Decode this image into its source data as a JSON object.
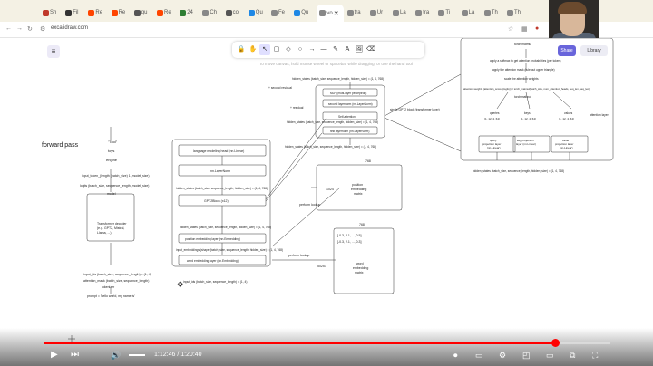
{
  "browser": {
    "url": "excalidraw.com",
    "active_tab_close": "✕",
    "tabs": [
      {
        "label": "Sh",
        "color": "#c0392b"
      },
      {
        "label": "Fil",
        "color": "#333"
      },
      {
        "label": "Re",
        "color": "#ff4500"
      },
      {
        "label": "Re",
        "color": "#ff4500"
      },
      {
        "label": "qu",
        "color": "#555"
      },
      {
        "label": "Re",
        "color": "#ff4500"
      },
      {
        "label": "24",
        "color": "#2e7d32"
      },
      {
        "label": "Ch",
        "color": "#888"
      },
      {
        "label": "co",
        "color": "#555"
      },
      {
        "label": "Qu",
        "color": "#1e88e5"
      },
      {
        "label": "Fe",
        "color": "#888"
      },
      {
        "label": "Qu",
        "color": "#1e88e5"
      },
      {
        "label": "vo",
        "color": "#888"
      },
      {
        "label": "tra",
        "color": "#888"
      },
      {
        "label": "Ur",
        "color": "#888"
      },
      {
        "label": "La",
        "color": "#888"
      },
      {
        "label": "tra",
        "color": "#888"
      },
      {
        "label": "Ti",
        "color": "#888"
      },
      {
        "label": "La",
        "color": "#888"
      },
      {
        "label": "Th",
        "color": "#888"
      },
      {
        "label": "Th",
        "color": "#888"
      }
    ]
  },
  "excalidraw": {
    "hint": "To move canvas, hold mouse wheel or spacebar while dragging, or use the hand tool",
    "share_label": "Share",
    "library_label": "Library",
    "tools": [
      "🔒",
      "✋",
      "↖",
      "▢",
      "◇",
      "○",
      "→",
      "—",
      "✎",
      "A",
      "🖼",
      "⌫"
    ]
  },
  "diagram": {
    "forward_pass": "forward pass",
    "left_col": {
      "text1": "\"Tool\"",
      "text2": "toys",
      "text3": "engine",
      "text4": "input_token_(length (batch_size) 1, model_size)",
      "text5": "logits (batch_size, sequence_length, model_size)",
      "text6": "model",
      "box": [
        "Transformer decoder",
        "(e.g. GPT2, Mistral,",
        "Llama, ...)"
      ],
      "text7": "input_ids (batch_size, sequence_length) = (1, 4)",
      "text8": "attention_mask (batch_size, sequence_length)",
      "text9": "tokenizer",
      "text10": "prompt = 'hello world, my name is'"
    },
    "mid_stack": {
      "lm_head": "language modeling head (nn.Linear)",
      "ln_f": "nn.LayerNorm",
      "gpt2block": "GPT2Block (x12)",
      "pos_emb": "position embedding layer (nn.Embedding)",
      "word_emb": "word embedding layer (nn.Embedding)",
      "hs1": "hidden_states (batch_size, sequence_length, hidden_size) = (1, 4, 768)",
      "hs2": "hidden_states (batch_size, sequence_length, hidden_size) = (1, 4, 768)",
      "pe_text": "input_embeddings (shape (batch_size, sequence_length, hidden_size) = (1, 4, 768)",
      "ids": "input_ids (batch_size, sequence_length) = (1, 4)",
      "perform_lookup1": "perform lookup",
      "perform_lookup2": "perform lookup"
    },
    "block": {
      "hs_top": "hidden_states (batch_size, sequence_length, hidden_size) = (1, 4, 768)",
      "residual1": "+ second residual",
      "mlp": "MLP (multi-layer perceptron)",
      "ln2": "second layernorm (nn.LayerNorm)",
      "residual2": "+ residual",
      "attn": "Self-attention",
      "ln1": "first layernorm (nn.LayerNorm)",
      "label": "single GPT2 block (transformer layer)",
      "hs_mid": "hidden_states (batch_size, sequence_length, hidden_size) = (1, 4, 768)",
      "hs_bottom": "hidden_states (batch_size, sequence_length, hidden_size) = (1, 4, 768)"
    },
    "attention": {
      "title": "attention layer",
      "torch_matmul": "torch.matmul",
      "softmax": "apply a softmax to get attention probabilities (per token)",
      "mask": "apply the attention mask (rule out upper triangle)",
      "scale": "scale the attention weights",
      "weights": "attention weights (attention_scores(logits)) = torch_matmul(batch_size, num_attention_heads, seq_len, seq_len)",
      "matmul2": "torch.matmul",
      "queries": "queries",
      "keys": "keys",
      "values": "values",
      "q_shape": "(1, 12, 4, 64)",
      "k_shape": "(1, 12, 4, 64)",
      "v_shape": "(1, 12, 4, 64)",
      "q_proj": [
        "query",
        "projection layer",
        "(nn.Linear)"
      ],
      "k_proj": [
        "key projection",
        "layer (nn.Linear)"
      ],
      "v_proj": [
        "value",
        "projection layer",
        "(nn.Linear)"
      ],
      "input": "hidden_states (batch_size, sequence_length, hidden_size) = (1, 4, 768)"
    },
    "pos_matrix": {
      "label": "768",
      "dim": "1024",
      "lines": [
        "position",
        "embedding",
        "matrix"
      ]
    },
    "word_matrix": {
      "label": "768",
      "dim": "50257",
      "rows": [
        "[-0.3, 2.1, ..., 0.5]",
        "[-0.3, 2.1, ..., 0.3]"
      ],
      "lines": [
        "word",
        "embedding",
        "matrix"
      ]
    }
  },
  "player": {
    "time_current": "1:12:46",
    "time_total": "1:20:40",
    "progress": 0.902
  }
}
